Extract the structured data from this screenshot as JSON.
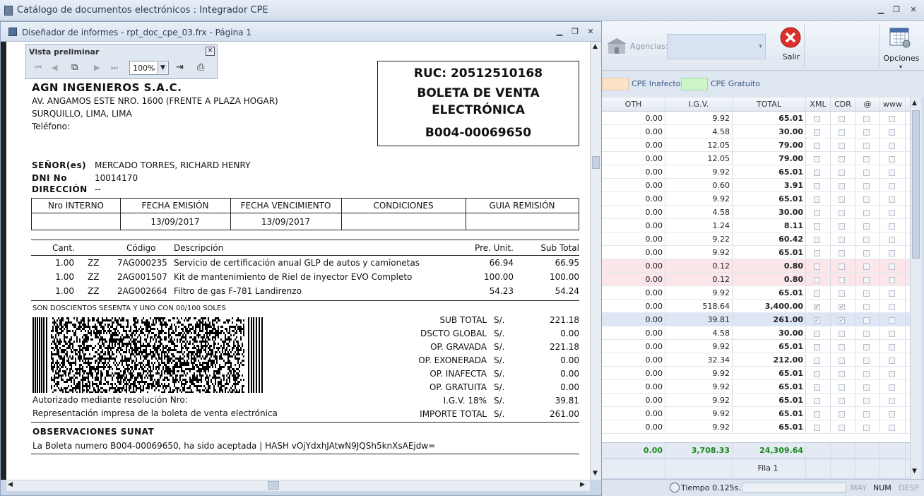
{
  "app": {
    "title": "Catálogo de documentos electrónicos : Integrador CPE"
  },
  "report_window": {
    "title": "Diseñador de informes - rpt_doc_cpe_03.frx - Página 1"
  },
  "preview": {
    "title": "Vista preliminar",
    "zoom": "100%"
  },
  "toolbar": {
    "agencias_label": "Agencias:",
    "salir_label": "Salir",
    "opciones_label": "Opciones"
  },
  "legend": {
    "inafecto": "CPE Inafecto",
    "gratuito": "CPE Gratuito",
    "inafecto_color": "#fde2c8",
    "gratuito_color": "#cdf5c9"
  },
  "grid": {
    "headers": [
      "OTH",
      "I.G.V.",
      "TOTAL",
      "XML",
      "CDR",
      "@",
      "www"
    ],
    "rows": [
      {
        "oth": "0.00",
        "igv": "9.92",
        "total": "65.01"
      },
      {
        "oth": "0.00",
        "igv": "4.58",
        "total": "30.00"
      },
      {
        "oth": "0.00",
        "igv": "12.05",
        "total": "79.00"
      },
      {
        "oth": "0.00",
        "igv": "12.05",
        "total": "79.00"
      },
      {
        "oth": "0.00",
        "igv": "9.92",
        "total": "65.01"
      },
      {
        "oth": "0.00",
        "igv": "0.60",
        "total": "3.91"
      },
      {
        "oth": "0.00",
        "igv": "9.92",
        "total": "65.01"
      },
      {
        "oth": "0.00",
        "igv": "4.58",
        "total": "30.00"
      },
      {
        "oth": "0.00",
        "igv": "1.24",
        "total": "8.11"
      },
      {
        "oth": "0.00",
        "igv": "9.22",
        "total": "60.42"
      },
      {
        "oth": "0.00",
        "igv": "9.92",
        "total": "65.01"
      },
      {
        "oth": "0.00",
        "igv": "0.12",
        "total": "0.80",
        "style": "pink"
      },
      {
        "oth": "0.00",
        "igv": "0.12",
        "total": "0.80",
        "style": "pink"
      },
      {
        "oth": "0.00",
        "igv": "9.92",
        "total": "65.01"
      },
      {
        "oth": "0.00",
        "igv": "518.64",
        "total": "3,400.00",
        "xml": true,
        "cdr": true
      },
      {
        "oth": "0.00",
        "igv": "39.81",
        "total": "261.00",
        "xml": true,
        "cdr": true,
        "style": "sel"
      },
      {
        "oth": "0.00",
        "igv": "4.58",
        "total": "30.00"
      },
      {
        "oth": "0.00",
        "igv": "9.92",
        "total": "65.01"
      },
      {
        "oth": "0.00",
        "igv": "32.34",
        "total": "212.00"
      },
      {
        "oth": "0.00",
        "igv": "9.92",
        "total": "65.01"
      },
      {
        "oth": "0.00",
        "igv": "9.92",
        "total": "65.01"
      },
      {
        "oth": "0.00",
        "igv": "9.92",
        "total": "65.01"
      },
      {
        "oth": "0.00",
        "igv": "9.92",
        "total": "65.01"
      },
      {
        "oth": "0.00",
        "igv": "9.92",
        "total": "65.01"
      }
    ],
    "totals": {
      "oth": "0.00",
      "igv": "3,708.33",
      "total": "24,309.64"
    },
    "fila": "Fila 1"
  },
  "status": {
    "tiempo": "Tiempo 0.125s.",
    "may": "MAY",
    "num": "NUM",
    "desp": "DESP"
  },
  "report": {
    "company": "AGN INGENIEROS S.A.C.",
    "address1": "AV. ANGAMOS ESTE NRO. 1600 (FRENTE A PLAZA HOGAR)",
    "address2": "SURQUILLO, LIMA, LIMA",
    "phone_label": "Teléfono:",
    "ruc": "RUC: 20512510168",
    "doc_type1": "BOLETA DE VENTA",
    "doc_type2": "ELECTRÓNICA",
    "doc_number": "B004-00069650",
    "senor_label": "SEÑOR(es)",
    "senor": "MERCADO TORRES, RICHARD HENRY",
    "dni_label": "DNI No",
    "dni": "10014170",
    "dir_label": "DIRECCIÓN",
    "dir": "--",
    "info_headers": [
      "Nro INTERNO",
      "FECHA EMISIÓN",
      "FECHA VENCIMIENTO",
      "CONDICIONES",
      "GUIA REMISIÓN"
    ],
    "info_values": [
      "",
      "13/09/2017",
      "13/09/2017",
      "",
      ""
    ],
    "item_headers": {
      "cant": "Cant.",
      "codigo": "Código",
      "desc": "Descripción",
      "pu": "Pre. Unit.",
      "sub": "Sub Total"
    },
    "items": [
      {
        "cant": "1.00",
        "um": "ZZ",
        "codigo": "7AG000235",
        "desc": "Servicio de certificación anual GLP de autos y camionetas",
        "pu": "66.94",
        "sub": "66.95"
      },
      {
        "cant": "1.00",
        "um": "ZZ",
        "codigo": "2AG001507",
        "desc": "Kit de mantenimiento de Riel de inyector EVO Completo",
        "pu": "100.00",
        "sub": "100.00"
      },
      {
        "cant": "1.00",
        "um": "ZZ",
        "codigo": "2AG002664",
        "desc": "Filtro de gas F-781 Landirenzo",
        "pu": "54.23",
        "sub": "54.24"
      }
    ],
    "son": "SON DOSCIENTOS SESENTA Y UNO CON 00/100 SOLES",
    "summary": [
      {
        "label": "SUB TOTAL",
        "cur": "S/.",
        "val": "221.18"
      },
      {
        "label": "DSCTO GLOBAL",
        "cur": "S/.",
        "val": "0.00"
      },
      {
        "label": "OP. GRAVADA",
        "cur": "S/.",
        "val": "221.18"
      },
      {
        "label": "OP. EXONERADA",
        "cur": "S/.",
        "val": "0.00"
      },
      {
        "label": "OP. INAFECTA",
        "cur": "S/.",
        "val": "0.00"
      },
      {
        "label": "OP. GRATUITA",
        "cur": "S/.",
        "val": "0.00"
      },
      {
        "label": "I.G.V.  18%",
        "cur": "S/.",
        "val": "39.81"
      },
      {
        "label": "IMPORTE TOTAL",
        "cur": "S/.",
        "val": "261.00"
      }
    ],
    "autorizado": "Autorizado mediante resolución Nro:",
    "representacion": "Representación impresa de la boleta de venta electrónica",
    "obs_title": "OBSERVACIONES SUNAT",
    "obs_text": "La Boleta numero B004-00069650, ha sido aceptada |  HASH vOjYdxhJAtwN9JQSh5knXsAEjdw="
  }
}
